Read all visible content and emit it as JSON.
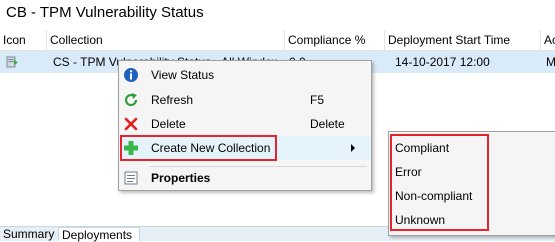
{
  "window": {
    "title": "CB - TPM Vulnerability Status"
  },
  "columns": [
    "Icon",
    "Collection",
    "Compliance %",
    "Deployment Start Time",
    "Ac"
  ],
  "row": {
    "icon": "deployment-icon",
    "collection": "CS - TPM Vulnerability Status - All Windows",
    "compliance": "0.0",
    "start_time": "14-10-2017 12:00",
    "action": "M"
  },
  "context_menu": {
    "items": [
      {
        "label": "View Status",
        "shortcut": "",
        "icon": "info-icon"
      },
      {
        "label": "Refresh",
        "shortcut": "F5",
        "icon": "refresh-icon"
      },
      {
        "label": "Delete",
        "shortcut": "Delete",
        "icon": "delete-x-icon"
      },
      {
        "label": "Create New Collection",
        "shortcut": "",
        "icon": "green-plus-icon"
      },
      {
        "label": "Properties",
        "shortcut": "",
        "icon": "properties-icon"
      }
    ]
  },
  "submenu": {
    "items": [
      "Compliant",
      "Error",
      "Non-compliant",
      "Unknown"
    ]
  },
  "bottom_tabs": [
    "Summary",
    "Deployments"
  ],
  "colors": {
    "highlight_red": "#e8232f",
    "selected_row": "#d9ebf9",
    "hover_item": "#e5f3fb"
  }
}
